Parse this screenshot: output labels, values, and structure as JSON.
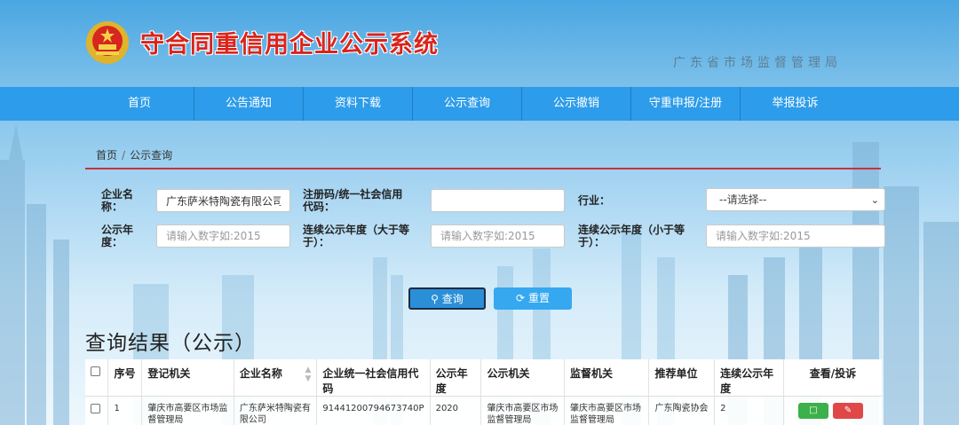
{
  "header": {
    "title": "守合同重信用企业公示系统",
    "subtitle": "广东省市场监督管理局"
  },
  "nav": [
    "首页",
    "公告通知",
    "资料下载",
    "公示查询",
    "公示撤销",
    "守重申报/注册",
    "举报投诉"
  ],
  "breadcrumb": {
    "home": "首页",
    "sep": "/",
    "current": "公示查询"
  },
  "form": {
    "company_label": "企业名称：",
    "company_value": "广东萨米特陶瓷有限公司",
    "code_label": "注册码/统一社会信用代码：",
    "code_value": "",
    "industry_label": "行业：",
    "industry_value": "--请选择--",
    "year_label": "公示年度：",
    "year_placeholder": "请输入数字如:2015",
    "cont_gte_label": "连续公示年度（大于等于）：",
    "cont_gte_placeholder": "请输入数字如:2015",
    "cont_lte_label": "连续公示年度（小于等于）：",
    "cont_lte_placeholder": "请输入数字如:2015",
    "search_label": "查询",
    "reset_label": "重置"
  },
  "results": {
    "title": "查询结果（公示）",
    "columns": [
      "序号",
      "登记机关",
      "企业名称",
      "企业统一社会信用代码",
      "公示年度",
      "公示机关",
      "监督机关",
      "推荐单位",
      "连续公示年度",
      "查看/投诉"
    ],
    "rows": [
      {
        "no": "1",
        "reg_org": "肇庆市高要区市场监督管理局",
        "company": "广东萨米特陶瓷有限公司",
        "credit_code": "91441200794673740P",
        "year": "2020",
        "pub_org": "肇庆市高要区市场监督管理局",
        "sup_org": "肇庆市高要区市场监督管理局",
        "recommender": "广东陶瓷协会",
        "continuous": "2"
      }
    ]
  },
  "colors": {
    "nav": "#2d9cea",
    "title": "#d9241c",
    "search_btn": "#2b8fd8",
    "view_btn": "#3cb04a",
    "complain_btn": "#e04848"
  }
}
